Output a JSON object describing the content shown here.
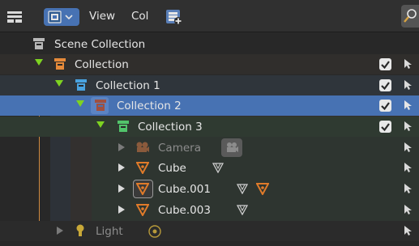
{
  "header": {
    "menus": [
      "View",
      "Col"
    ]
  },
  "tree": {
    "scene": "Scene Collection",
    "rows": [
      {
        "label": "Collection"
      },
      {
        "label": "Collection 1"
      },
      {
        "label": "Collection 2"
      },
      {
        "label": "Collection 3"
      },
      {
        "label": "Camera"
      },
      {
        "label": "Cube"
      },
      {
        "label": "Cube.001"
      },
      {
        "label": "Cube.003"
      },
      {
        "label": "Light"
      }
    ]
  },
  "colors": {
    "selected_row": "#4772b3",
    "collection_orange": "#e68a3a",
    "collection_blue": "#4aa3e0",
    "collection_red": "#b04a3a",
    "collection_green": "#52c46b",
    "mesh_orange": "#e07b2a",
    "expand_green": "#7ed321"
  },
  "icons": [
    "editor-type-icon",
    "display-mode-icon",
    "new-collection-icon",
    "search-icon",
    "collection-icon",
    "checkbox-icon",
    "select-cursor-icon",
    "camera-icon",
    "mesh-icon",
    "light-icon"
  ]
}
